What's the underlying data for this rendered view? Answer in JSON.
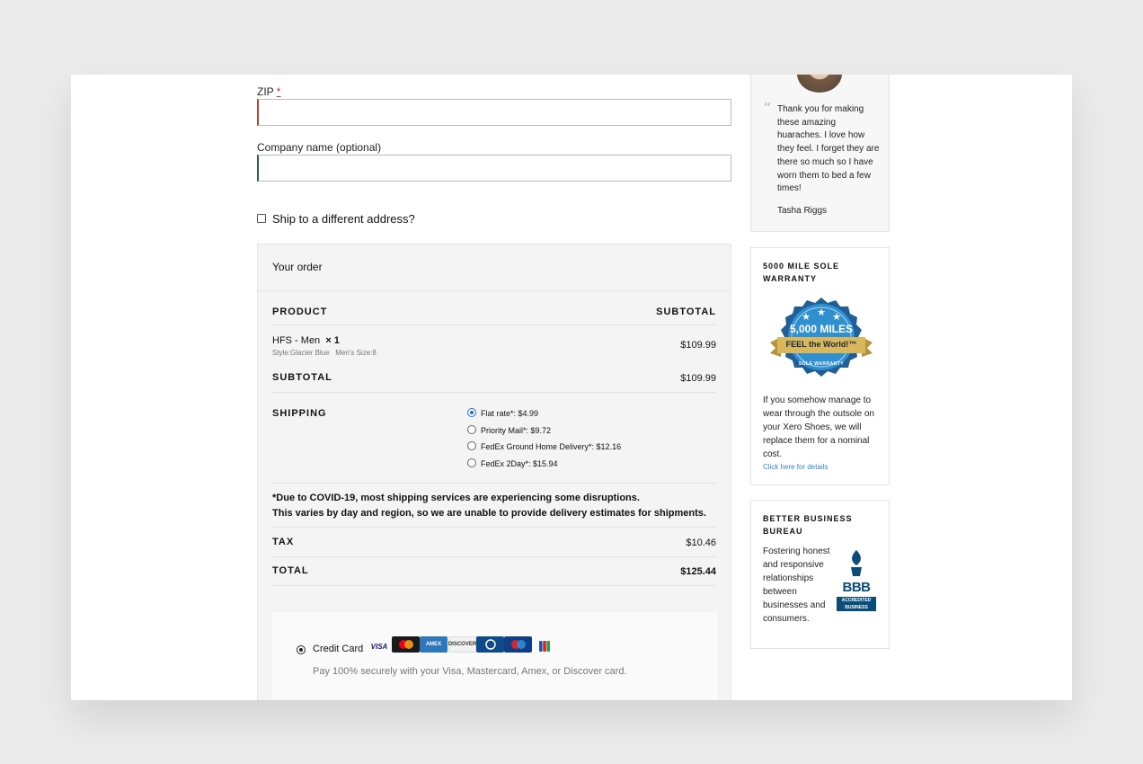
{
  "form": {
    "zip_label": "ZIP",
    "required_mark": "*",
    "zip_value": "",
    "company_label": "Company name (optional)",
    "company_value": "",
    "ship_different_label": "Ship to a different address?"
  },
  "order": {
    "title": "Your order",
    "col_product": "PRODUCT",
    "col_subtotal": "SUBTOTAL",
    "item": {
      "name": "HFS - Men",
      "qty": "× 1",
      "style": "Style:Glacier Blue",
      "size": "Men's Size:8",
      "price": "$109.99"
    },
    "subtotal_label": "SUBTOTAL",
    "subtotal_value": "$109.99",
    "shipping_label": "SHIPPING",
    "shipping_options": [
      {
        "label": "Flat rate*: $4.99",
        "selected": true
      },
      {
        "label": "Priority Mail*: $9.72",
        "selected": false
      },
      {
        "label": "FedEx Ground Home Delivery*: $12.16",
        "selected": false
      },
      {
        "label": "FedEx 2Day*: $15.94",
        "selected": false
      }
    ],
    "notice_line1": "*Due to COVID-19, most shipping services are experiencing some disruptions.",
    "notice_line2": "This varies by day and region, so we are unable to provide delivery estimates for shipments.",
    "tax_label": "TAX",
    "tax_value": "$10.46",
    "total_label": "TOTAL",
    "total_value": "$125.44"
  },
  "payment": {
    "method_label": "Credit Card",
    "description": "Pay 100% securely with your Visa, Mastercard, Amex, or Discover card.",
    "cards": [
      "visa",
      "mastercard",
      "amex",
      "discover",
      "diners",
      "maestro",
      "jcb"
    ]
  },
  "sidebar": {
    "testimonial": {
      "quote": "Thank you for making these amazing huaraches. I love how they feel. I forget they are there so much so I have worn them to bed a few times!",
      "author": "Tasha Riggs"
    },
    "warranty": {
      "title_line1": "5000 MILE SOLE",
      "title_line2": "WARRANTY",
      "badge_miles": "5,000 MILES",
      "badge_ribbon": "FEEL the World!™",
      "badge_bottom": "SOLE WARRANTY",
      "text": "If you somehow manage to wear through the outsole on your Xero Shoes, we will replace them for a nominal cost.",
      "link": "Click here for details"
    },
    "bbb": {
      "title_line1": "BETTER BUSINESS",
      "title_line2": "BUREAU",
      "text": "Fostering honest and responsive relationships between businesses and consumers.",
      "logo_text": "BBB",
      "logo_sub": "ACCREDITED BUSINESS"
    }
  },
  "colors": {
    "accent_blue": "#1e6fd9",
    "link_blue": "#3a86c8",
    "bbb_blue": "#0a4d7a",
    "badge_blue": "#2f8fd0",
    "badge_gold": "#c9a54a"
  }
}
